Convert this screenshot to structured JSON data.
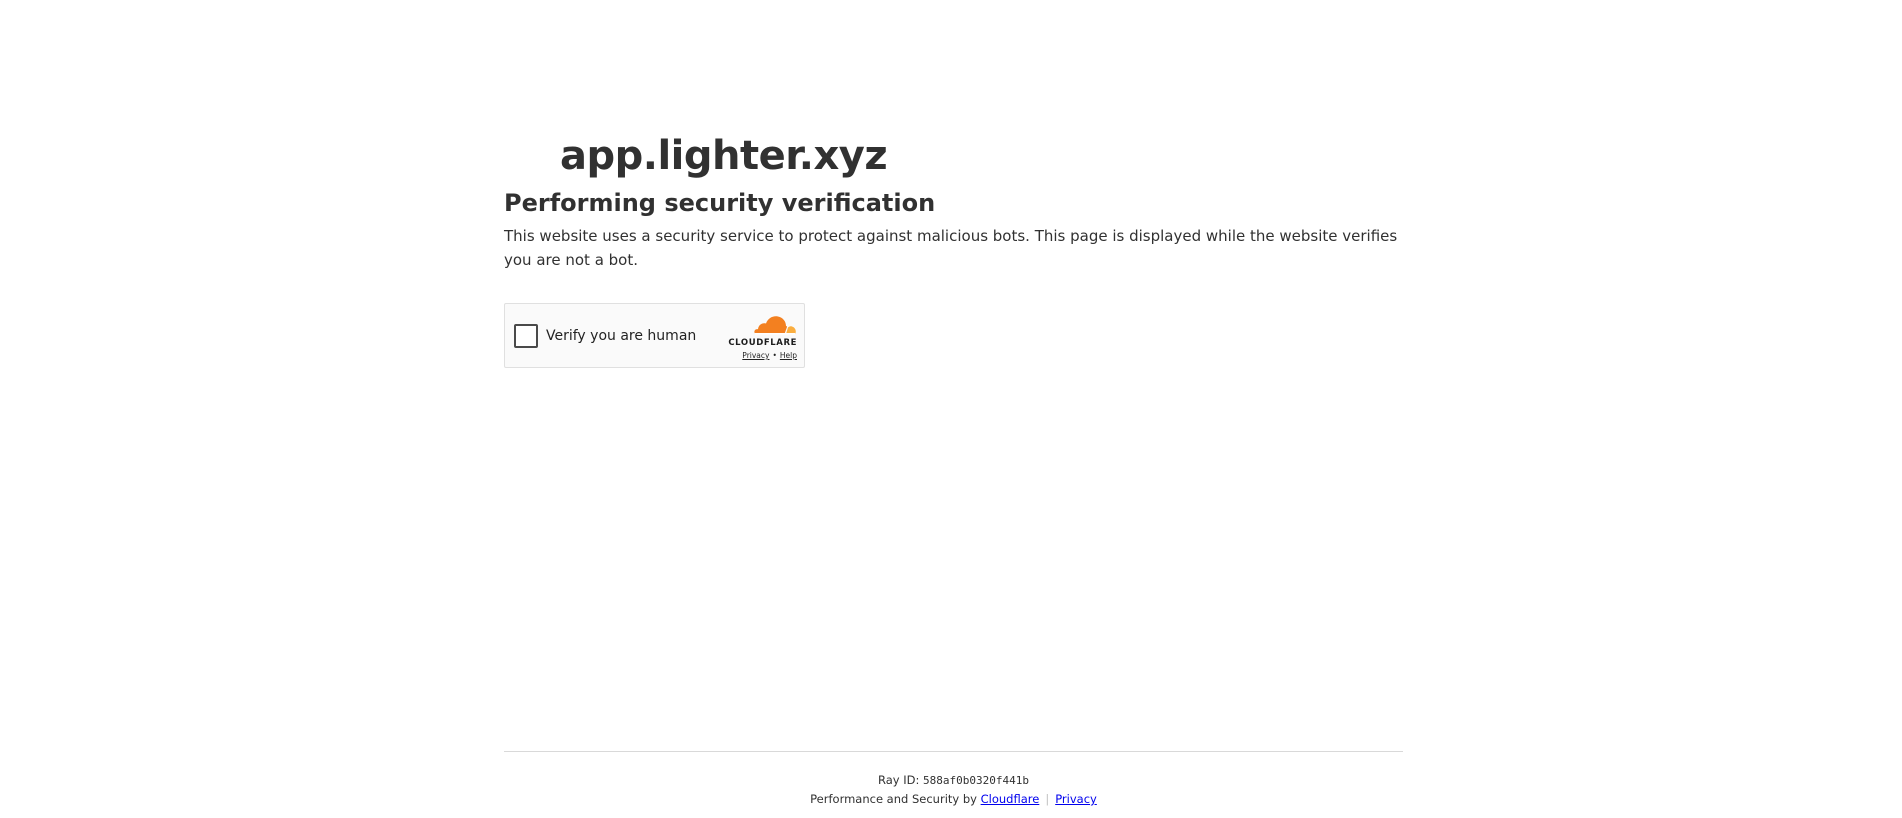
{
  "site": {
    "name": "app.lighter.xyz"
  },
  "challenge": {
    "heading": "Performing security verification",
    "description": "This website uses a security service to protect against malicious bots. This page is displayed while the website verifies you are not a bot."
  },
  "widget": {
    "label": "Verify you are human",
    "brand": "CLOUDFLARE",
    "privacy_link": "Privacy",
    "dot": "•",
    "help_link": "Help",
    "icon": "cloudflare-cloud-icon",
    "colors": {
      "cloud_dark": "#f38020",
      "cloud_light": "#faae40"
    }
  },
  "footer": {
    "ray_label": "Ray ID: ",
    "ray_id": "588af0b0320f441b",
    "perf_text": "Performance and Security by ",
    "cloudflare_link": "Cloudflare",
    "separator": "|",
    "privacy_link": "Privacy"
  }
}
